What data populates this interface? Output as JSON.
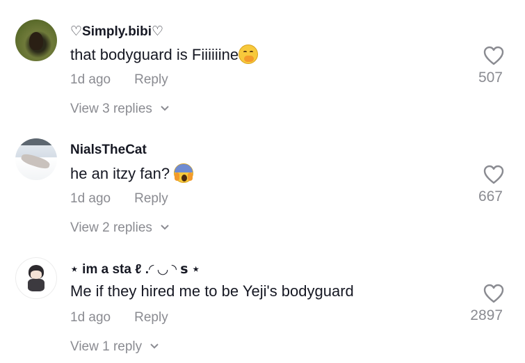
{
  "comments": [
    {
      "username": "♡Simply.bibi♡",
      "text": "that bodyguard is Fiiiiiine",
      "emoji": "hand-over-mouth-emoji",
      "time": "1d ago",
      "reply_label": "Reply",
      "likes": "507",
      "view_replies": "View 3 replies"
    },
    {
      "username": "NialsTheCat",
      "text": "he an itzy fan?",
      "emoji": "face-screaming-in-fear-emoji",
      "time": "1d ago",
      "reply_label": "Reply",
      "likes": "667",
      "view_replies": "View 2 replies"
    },
    {
      "username": "⋆ im a sta ℓ .◜ ◡ ◝ ꜱ ⋆",
      "text": "Me if they hired me to be Yeji's bodyguard",
      "time": "1d ago",
      "reply_label": "Reply",
      "likes": "2897",
      "view_replies": "View 1 reply"
    }
  ],
  "colors": {
    "text_primary": "#161823",
    "text_secondary": "#8a8b91",
    "background": "#ffffff"
  }
}
